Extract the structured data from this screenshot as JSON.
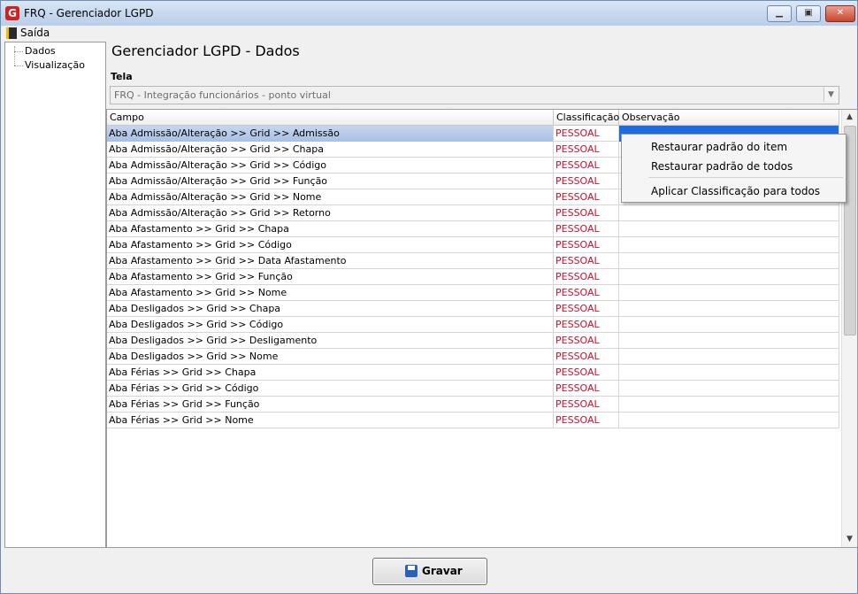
{
  "window": {
    "app_icon": "G",
    "title": "FRQ - Gerenciador LGPD",
    "min_icon": "▁",
    "max_icon": "▣",
    "close_icon": "✕"
  },
  "menu": {
    "exit_label": "Saída"
  },
  "sidebar": {
    "items": [
      {
        "label": "Dados"
      },
      {
        "label": "Visualização"
      }
    ]
  },
  "main": {
    "title": "Gerenciador LGPD - Dados",
    "tela_label": "Tela",
    "tela_value": "FRQ - Integração funcionários - ponto virtual",
    "combo_arrow": "▼"
  },
  "grid": {
    "columns": [
      "Campo",
      "Classificação",
      "Observação"
    ],
    "rows": [
      {
        "campo": "Aba Admissão/Alteração >> Grid >> Admissão",
        "classificacao": "PESSOAL",
        "observacao": ""
      },
      {
        "campo": "Aba Admissão/Alteração >> Grid >> Chapa",
        "classificacao": "PESSOAL",
        "observacao": ""
      },
      {
        "campo": "Aba Admissão/Alteração >> Grid >> Código",
        "classificacao": "PESSOAL",
        "observacao": ""
      },
      {
        "campo": "Aba Admissão/Alteração >> Grid >> Função",
        "classificacao": "PESSOAL",
        "observacao": ""
      },
      {
        "campo": "Aba Admissão/Alteração >> Grid >> Nome",
        "classificacao": "PESSOAL",
        "observacao": ""
      },
      {
        "campo": "Aba Admissão/Alteração >> Grid >> Retorno",
        "classificacao": "PESSOAL",
        "observacao": ""
      },
      {
        "campo": "Aba Afastamento >> Grid >> Chapa",
        "classificacao": "PESSOAL",
        "observacao": ""
      },
      {
        "campo": "Aba Afastamento >> Grid >> Código",
        "classificacao": "PESSOAL",
        "observacao": ""
      },
      {
        "campo": "Aba Afastamento >> Grid >> Data Afastamento",
        "classificacao": "PESSOAL",
        "observacao": ""
      },
      {
        "campo": "Aba Afastamento >> Grid >> Função",
        "classificacao": "PESSOAL",
        "observacao": ""
      },
      {
        "campo": "Aba Afastamento >> Grid >> Nome",
        "classificacao": "PESSOAL",
        "observacao": ""
      },
      {
        "campo": "Aba Desligados >> Grid >> Chapa",
        "classificacao": "PESSOAL",
        "observacao": ""
      },
      {
        "campo": "Aba Desligados >> Grid >> Código",
        "classificacao": "PESSOAL",
        "observacao": ""
      },
      {
        "campo": "Aba Desligados >> Grid >> Desligamento",
        "classificacao": "PESSOAL",
        "observacao": ""
      },
      {
        "campo": "Aba Desligados >> Grid >> Nome",
        "classificacao": "PESSOAL",
        "observacao": ""
      },
      {
        "campo": "Aba Férias >> Grid >> Chapa",
        "classificacao": "PESSOAL",
        "observacao": ""
      },
      {
        "campo": "Aba Férias >> Grid >> Código",
        "classificacao": "PESSOAL",
        "observacao": ""
      },
      {
        "campo": "Aba Férias >> Grid >> Função",
        "classificacao": "PESSOAL",
        "observacao": ""
      },
      {
        "campo": "Aba Férias >> Grid >> Nome",
        "classificacao": "PESSOAL",
        "observacao": ""
      }
    ],
    "scroll_up": "▲",
    "scroll_down": "▼"
  },
  "context_menu": {
    "items": [
      "Restaurar padrão do item",
      "Restaurar padrão de todos",
      "Aplicar Classificação para todos"
    ]
  },
  "save_button": {
    "label": "Gravar"
  },
  "colors": {
    "classification_text": "#c8102e",
    "selection_blue": "#1e6ce0"
  }
}
